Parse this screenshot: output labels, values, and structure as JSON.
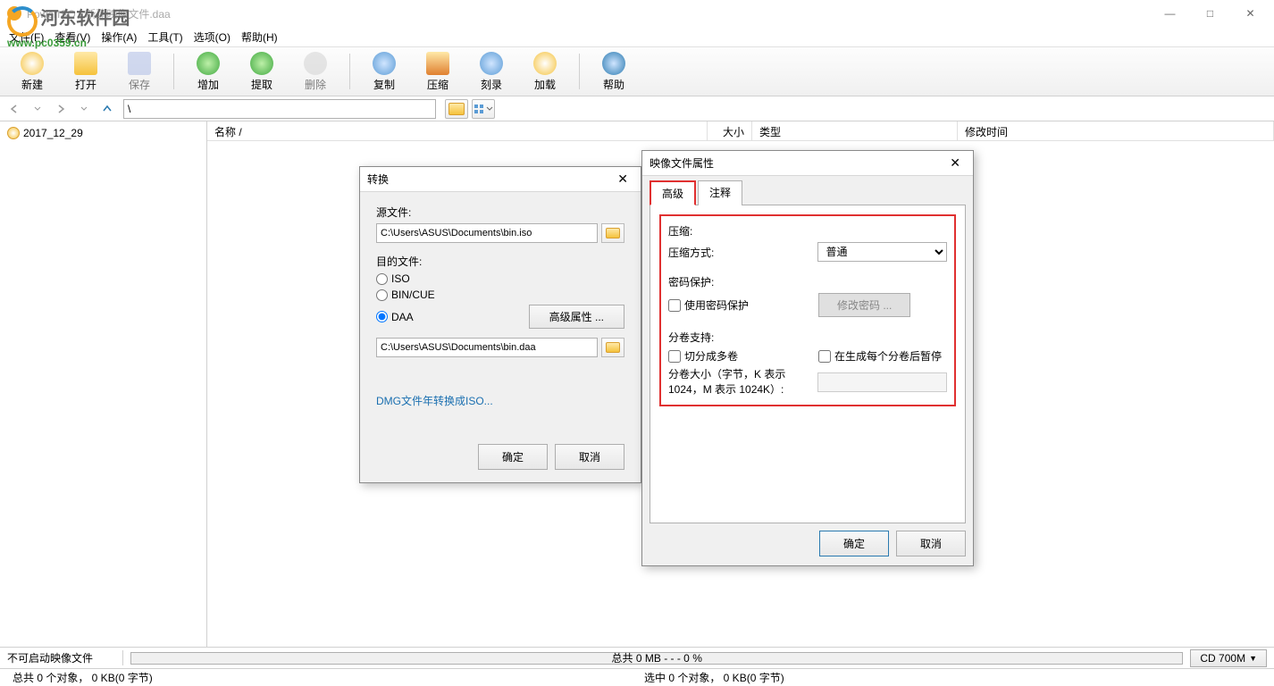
{
  "window": {
    "title": "PowerISO - 新建映像文件.daa",
    "min": "—",
    "max": "□",
    "close": "✕"
  },
  "watermark": {
    "text": "河东软件园",
    "url": "www.pc0359.cn"
  },
  "menu": {
    "file": "文件(F)",
    "view": "查看(V)",
    "action": "操作(A)",
    "tools": "工具(T)",
    "options": "选项(O)",
    "help": "帮助(H)"
  },
  "toolbar": {
    "new": "新建",
    "open": "打开",
    "save": "保存",
    "add": "增加",
    "extract": "提取",
    "delete": "删除",
    "copy": "复制",
    "compress": "压缩",
    "burn": "刻录",
    "mount": "加载",
    "help": "帮助"
  },
  "nav": {
    "path": "\\"
  },
  "tree": {
    "item0": "2017_12_29"
  },
  "cols": {
    "name": "名称  /",
    "size": "大小",
    "type": "类型",
    "mtime": "修改时间"
  },
  "progress": {
    "label": "不可启动映像文件",
    "text": "总共  0 MB  - - -  0 %",
    "cd": "CD 700M",
    "caret": "▼"
  },
  "status": {
    "left": "总共 0 个对象，  0 KB(0 字节)",
    "right": "选中 0 个对象，  0 KB(0 字节)"
  },
  "convert": {
    "title": "转换",
    "src_label": "源文件:",
    "src_value": "C:\\Users\\ASUS\\Documents\\bin.iso",
    "dst_label": "目的文件:",
    "opt_iso": "ISO",
    "opt_bincue": "BIN/CUE",
    "opt_daa": "DAA",
    "adv_btn": "高级属性 ...",
    "dst_value": "C:\\Users\\ASUS\\Documents\\bin.daa",
    "link": "DMG文件年转换成ISO...",
    "ok": "确定",
    "cancel": "取消"
  },
  "props": {
    "title": "映像文件属性",
    "tab_adv": "高级",
    "tab_note": "注释",
    "compress_hdr": "压缩:",
    "compress_method_label": "压缩方式:",
    "compress_method_value": "普通",
    "pwd_hdr": "密码保护:",
    "pwd_use": "使用密码保护",
    "pwd_change": "修改密码 ...",
    "vol_hdr": "分卷支持:",
    "vol_split": "切分成多卷",
    "vol_pause": "在生成每个分卷后暂停",
    "vol_size_label": "分卷大小（字节，K 表示 1024，M 表示 1024K）:",
    "ok": "确定",
    "cancel": "取消"
  }
}
